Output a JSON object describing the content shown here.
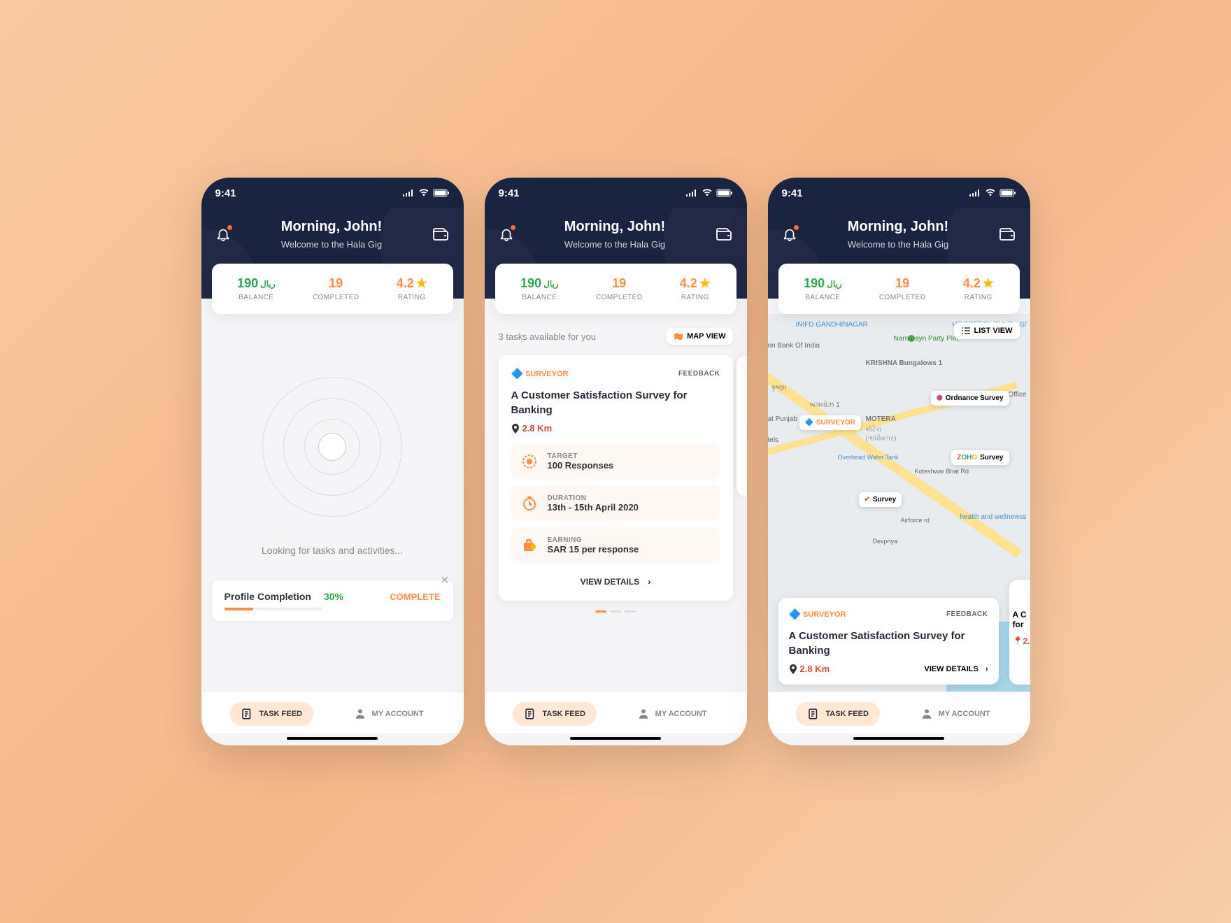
{
  "status": {
    "time": "9:41"
  },
  "header": {
    "greeting": "Morning, John!",
    "subtitle": "Welcome to the Hala Gig"
  },
  "stats": {
    "balance": {
      "value": "190",
      "currency": "ريال",
      "label": "BALANCE"
    },
    "completed": {
      "value": "19",
      "label": "COMPLETED"
    },
    "rating": {
      "value": "4.2",
      "label": "RATING"
    }
  },
  "loading_text": "Looking for tasks and activities...",
  "profile": {
    "label": "Profile Completion",
    "percent": "30%",
    "action": "COMPLETE"
  },
  "tasks_header": {
    "count_text": "3 tasks available for you",
    "map_view": "MAP VIEW",
    "list_view": "LIST VIEW"
  },
  "task": {
    "brand": "SURVEYOR",
    "tag": "FEEDBACK",
    "title": "A Customer Satisfaction Survey for Banking",
    "distance": "2.8 Km",
    "target": {
      "label": "TARGET",
      "value": "100 Responses"
    },
    "duration": {
      "label": "DURATION",
      "value": "13th - 15th April 2020"
    },
    "earning": {
      "label": "EARNING",
      "value": "SAR 15 per response"
    },
    "view_details": "VIEW DETAILS"
  },
  "map_pins": {
    "ordnance": "Ordnance Survey",
    "zoho": "Survey",
    "check": "Survey",
    "surveyor": "SURVEYOR"
  },
  "map_labels": {
    "inifd": "INIFD GANDHINAGAR",
    "petrol": "HP PETROL PUMP - S/",
    "narnarayn": "Narnarayn Party Plot",
    "bank": "on Bank Of India",
    "krishna": "KRISHNA Bungalows 1",
    "office": "st Office",
    "punjab": "at Punjab",
    "motera": "MOTERA",
    "motera_g": "મોટેરા",
    "motera_h": "(ગાંધીવગર)",
    "bungalow_g": "બંગલોઝ 1",
    "krupa": "કૃષ્ણા",
    "tels": "tels",
    "overhead": "Overhead Water Tank",
    "koteshwar": "Koteshwar Bhat Rd",
    "airforce": "Airforce rd",
    "devpriya": "Devpriya",
    "health": "health and wellnewss"
  },
  "map_peek": {
    "title_prefix": "A C",
    "title_line2": "for",
    "dist": "2."
  },
  "nav": {
    "feed": "TASK FEED",
    "account": "MY ACCOUNT"
  }
}
